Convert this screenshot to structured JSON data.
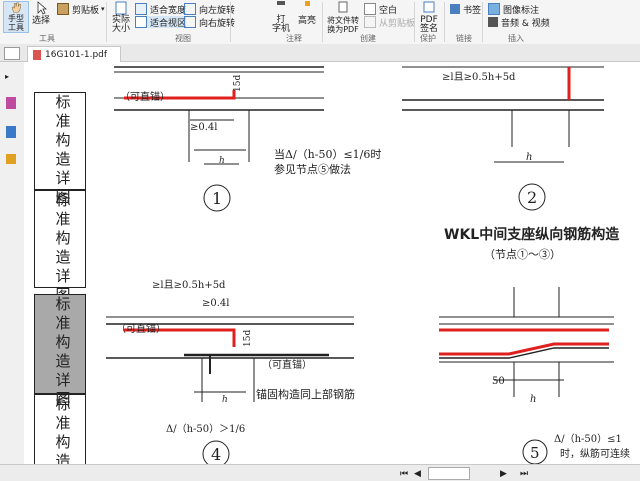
{
  "ribbon": {
    "hand_tool": "手型\n工具",
    "select": "选择",
    "tools_group": "工具",
    "clipboard": "剪贴板",
    "actual_size": "实际\n大小",
    "fit_width": "适合宽度",
    "fit_page": "适合视区",
    "rotate_left": "向左旋转",
    "rotate_right": "向右旋转",
    "view_group": "视图",
    "typewriter": "打\n字机",
    "highlight": "高亮",
    "comment_group": "注释",
    "file_to_pdf": "将文件转\n换为PDF",
    "blank": "空白",
    "from_clipboard": "从剪贴板",
    "create_group": "创建",
    "pdf_sign": "PDF\n签名",
    "protect_group": "保护",
    "bookmark": "书签",
    "link_group": "链接",
    "image_annot": "图像标注",
    "audio_video": "音频 & 视频",
    "insert_group": "插入"
  },
  "tab": {
    "filename": "16G101-1.pdf"
  },
  "side_cells": [
    {
      "text": "标准构造详图"
    },
    {
      "text": "标准构造详图"
    },
    {
      "text": "标准构造详图"
    },
    {
      "text": "标准构造"
    }
  ],
  "drawing": {
    "title": "WKL中间支座纵向钢筋构造",
    "subtitle": "（节点①～③）",
    "d1_anchor": "（可直锚）",
    "d1_len": "≥0.4l",
    "d1_15d": "15d",
    "d1_note1": "当Δ",
    "d1_note1b": "/（h",
    "d1_note1c": "-50）≤1/6时",
    "d1_note2": "参见节点⑤做法",
    "d1_num": "1",
    "d2_len": "≥l",
    "d2_len2": "且≥0.5h",
    "d2_len3": "+5d",
    "d2_num": "2",
    "d4_len": "≥l",
    "d4_len2": "且≥0.5h",
    "d4_len3": "+5d",
    "d4_len4": "≥0.4l",
    "d4_anchor": "（可直锚）",
    "d4_anchor2": "（可直锚）",
    "d4_15d": "15d",
    "d4_note": "锚固构造同上部钢筋",
    "d4_formula": "Δ",
    "d4_formula2": "/（h",
    "d4_formula3": "-50）＞1/6",
    "d4_num": "4",
    "d5_50": "50",
    "d5_formula": "Δ",
    "d5_formula2": "/（h",
    "d5_formula3": "-50）≤1",
    "d5_note": "时，纵筋可连续",
    "d5_num": "5",
    "hc": "h",
    "lae": "l",
    "delta": "Δ"
  },
  "colors": {
    "rebar_red": "#e0201e",
    "ribbon_bg": "#f5f5f5"
  }
}
